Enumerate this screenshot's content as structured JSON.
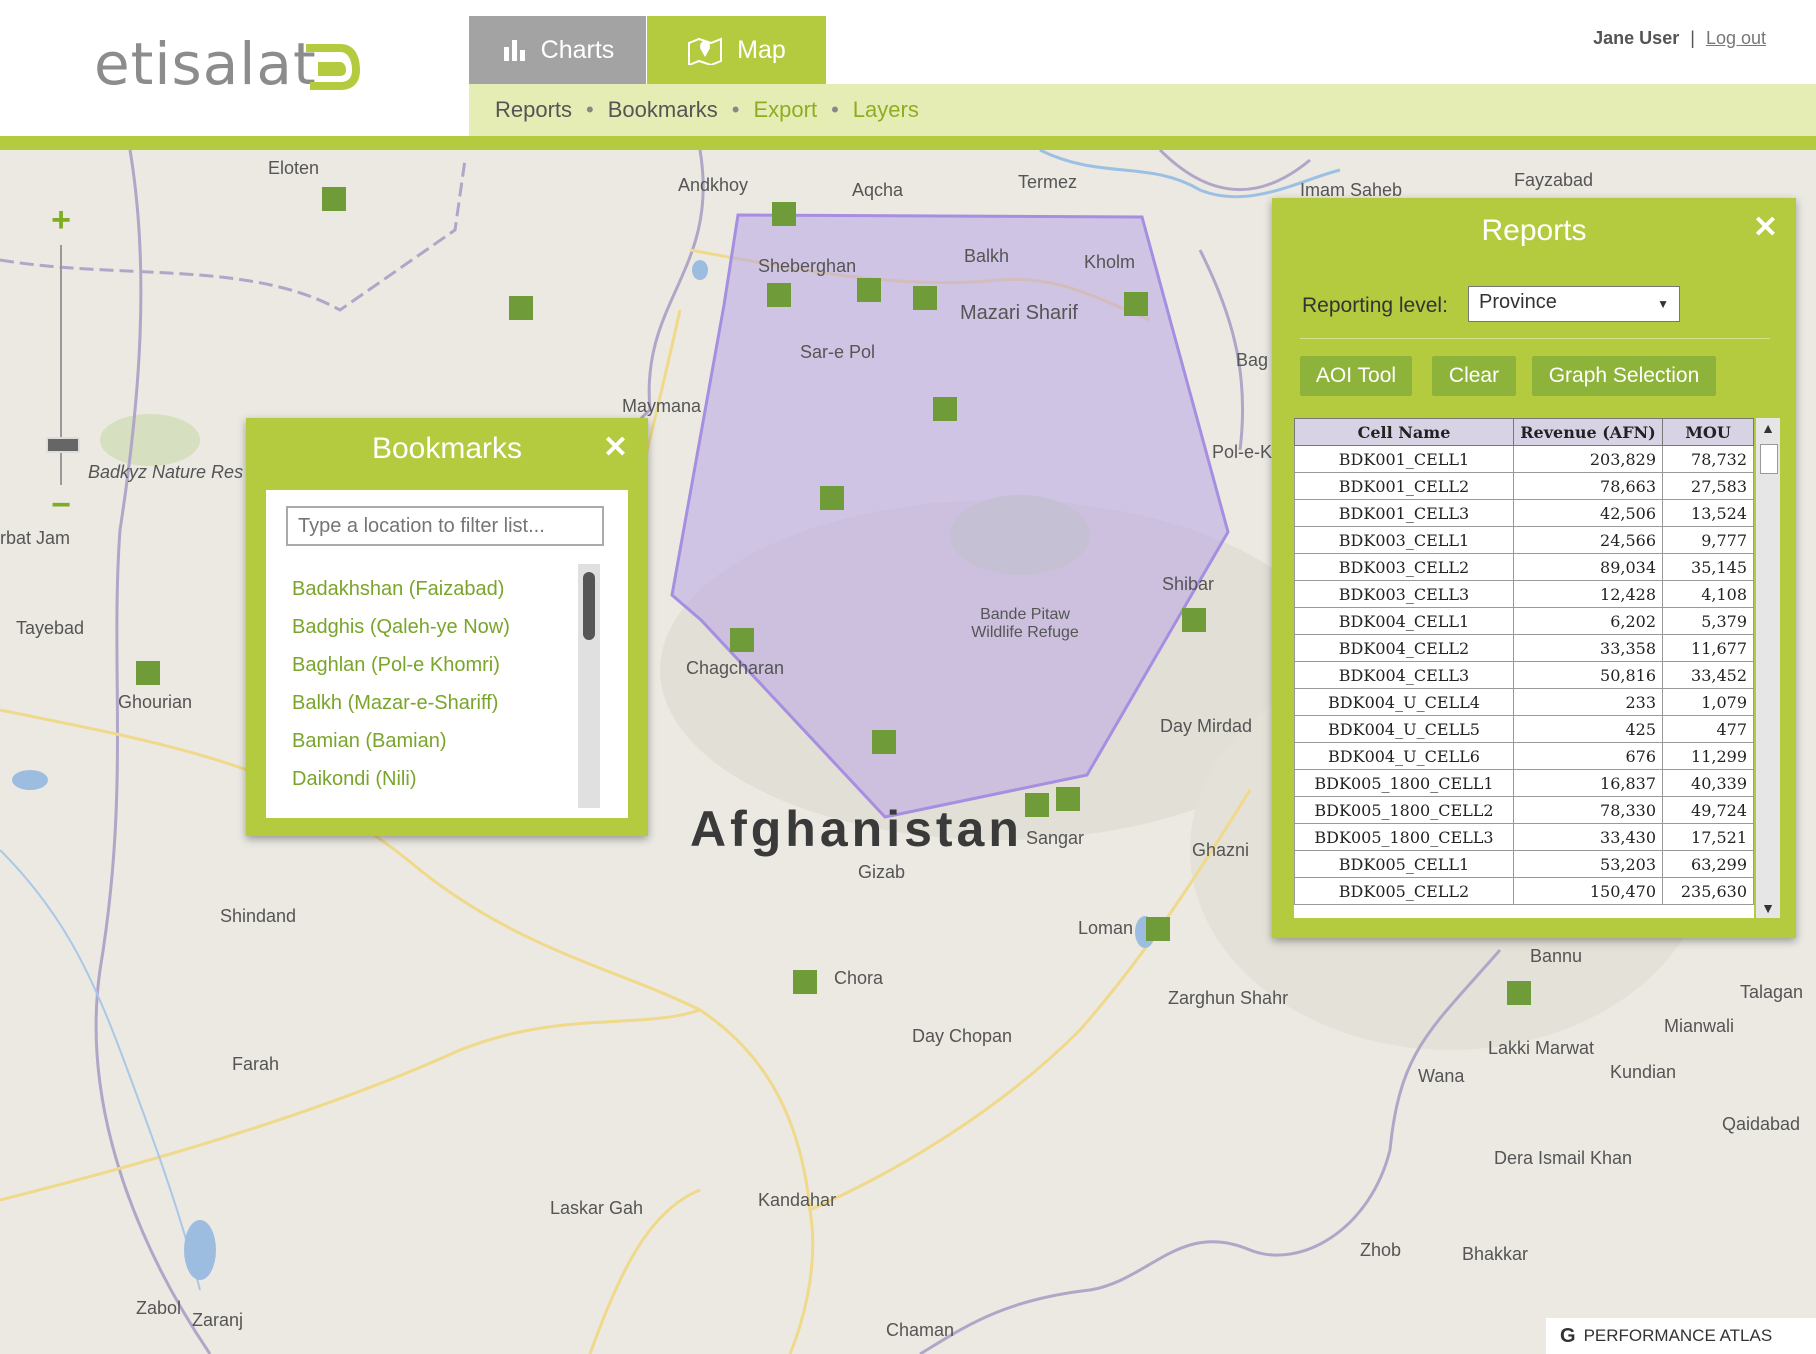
{
  "header": {
    "logo_text": "etisalat",
    "tabs": [
      {
        "label": "Charts",
        "icon": "bar-chart-icon"
      },
      {
        "label": "Map",
        "icon": "map-icon"
      }
    ],
    "subnav": [
      "Reports",
      "Bookmarks",
      "Export",
      "Layers"
    ],
    "subnav_separator": "•",
    "user_name": "Jane User",
    "user_separator": "|",
    "logout_label": "Log out"
  },
  "colors": {
    "brand_green": "#b5cb3f",
    "marker_green": "#6f9c39",
    "tab_grey": "#a3a3a3",
    "polygon": "#b9a6e6"
  },
  "map": {
    "country_label": "Afghanistan",
    "places": [
      "Eloten",
      "Andkhoy",
      "Aqcha",
      "Termez",
      "Imam Saheb",
      "Fayzabad",
      "Sheberghan",
      "Balkh",
      "Kholm",
      "Mazari Sharif",
      "Sar-e Pol",
      "Maymana",
      "Badkyz Nature Res",
      "Pol-e-K",
      "Bag",
      "Shibar",
      "Bande Pitaw Wildlife Refuge",
      "Chagcharan",
      "Tayebad",
      "Ghourian",
      "Day Mirdad",
      "Sangar",
      "Gizab",
      "Ghazni",
      "Loman",
      "Shindand",
      "Chora",
      "Zarghun Shahr",
      "Day Chopan",
      "Farah",
      "Bannu",
      "Talagan",
      "Mianwali",
      "Lakki Marwat",
      "Kundian",
      "Wana",
      "Qaidabad",
      "Dera Ismail Khan",
      "Laskar Gah",
      "Kandahar",
      "Zhob",
      "Bhakkar",
      "Zabol",
      "Zaranj",
      "Chaman",
      "rbat Jam"
    ],
    "markers": 25
  },
  "zoom": {
    "in": "+",
    "out": "−"
  },
  "bookmarks": {
    "title": "Bookmarks",
    "close": "✕",
    "filter_placeholder": "Type a location to filter list...",
    "items": [
      "Badakhshan (Faizabad)",
      "Badghis (Qaleh-ye Now)",
      "Baghlan (Pol-e Khomri)",
      "Balkh (Mazar-e-Shariff)",
      "Bamian (Bamian)",
      "Daikondi (Nili)"
    ]
  },
  "reports": {
    "title": "Reports",
    "close": "✕",
    "level_label": "Reporting level:",
    "level_value": "Province",
    "buttons": [
      "AOI Tool",
      "Clear",
      "Graph Selection"
    ],
    "columns": [
      "Cell Name",
      "Revenue (AFN)",
      "MOU"
    ],
    "rows": [
      [
        "BDK001_CELL1",
        "203,829",
        "78,732"
      ],
      [
        "BDK001_CELL2",
        "78,663",
        "27,583"
      ],
      [
        "BDK001_CELL3",
        "42,506",
        "13,524"
      ],
      [
        "BDK003_CELL1",
        "24,566",
        "9,777"
      ],
      [
        "BDK003_CELL2",
        "89,034",
        "35,145"
      ],
      [
        "BDK003_CELL3",
        "12,428",
        "4,108"
      ],
      [
        "BDK004_CELL1",
        "6,202",
        "5,379"
      ],
      [
        "BDK004_CELL2",
        "33,358",
        "11,677"
      ],
      [
        "BDK004_CELL3",
        "50,816",
        "33,452"
      ],
      [
        "BDK004_U_CELL4",
        "233",
        "1,079"
      ],
      [
        "BDK004_U_CELL5",
        "425",
        "477"
      ],
      [
        "BDK004_U_CELL6",
        "676",
        "11,299"
      ],
      [
        "BDK005_1800_CELL1",
        "16,837",
        "40,339"
      ],
      [
        "BDK005_1800_CELL2",
        "78,330",
        "49,724"
      ],
      [
        "BDK005_1800_CELL3",
        "33,430",
        "17,521"
      ],
      [
        "BDK005_CELL1",
        "53,203",
        "63,299"
      ],
      [
        "BDK005_CELL2",
        "150,470",
        "235,630"
      ]
    ]
  },
  "footer": {
    "label": "PERFORMANCE ATLAS"
  }
}
